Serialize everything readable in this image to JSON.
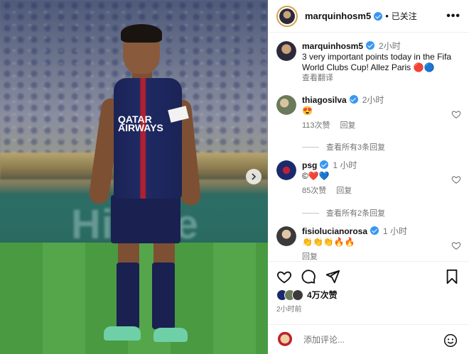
{
  "photo": {
    "board_text": "Hi  nse",
    "sponsor_text": "QATAR AIRWAYS"
  },
  "post": {
    "author": "marquinhosm5",
    "follow_status": "已关注",
    "caption_time": "2小时",
    "caption": "3 very important points today in the Fifa World Clubs Cup! Allez Paris 🔴🔵",
    "translate": "查看翻译"
  },
  "comments": [
    {
      "user": "thiagosilva",
      "time": "2小时",
      "text": "😍",
      "likes": "113次赞",
      "reply": "回复",
      "view_replies": "查看所有3条回复",
      "avatar_color": "#6a7a5a"
    },
    {
      "user": "psg",
      "time": "1 小时",
      "text": "©❤️💙",
      "likes": "85次赞",
      "reply": "回复",
      "view_replies": "查看所有2条回复",
      "avatar_color": "#1b2a6b"
    },
    {
      "user": "fisiolucianorosa",
      "time": "1 小时",
      "text": "👏👏👏🔥🔥",
      "likes": "",
      "reply": "回复",
      "avatar_color": "#3a3a3a"
    }
  ],
  "actions": {
    "likes_count": "4万次赞",
    "ago": "2小时前",
    "comment_placeholder": "添加评论..."
  },
  "icons": [
    "heart-icon",
    "comment-icon",
    "share-icon",
    "bookmark-icon",
    "emoji-icon",
    "more-icon",
    "chevron-right-icon",
    "verified-icon"
  ],
  "colors": {
    "verified": "#3897f0",
    "muted": "#737373",
    "psg_navy": "#1b2a6b"
  }
}
